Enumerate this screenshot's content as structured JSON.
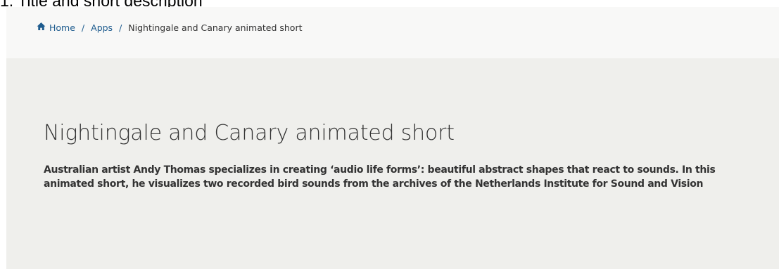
{
  "caption": "1. Title and short description",
  "breadcrumb": {
    "home_label": "Home",
    "home_icon": "home-icon",
    "separator": "/",
    "apps_label": "Apps",
    "current_label": "Nightingale and Canary animated short"
  },
  "hero": {
    "title": "Nightingale and Canary animated short",
    "description": "Australian artist Andy Thomas specializes in creating ‘audio life forms’: beautiful abstract shapes that react to sounds. In this animated short, he visualizes two recorded bird sounds from the archives of the Netherlands Institute for Sound and Vision"
  },
  "colors": {
    "link": "#1d5b8e",
    "breadcrumb_background": "#f8f8f7",
    "hero_background": "#efefec",
    "text": "#333333"
  }
}
